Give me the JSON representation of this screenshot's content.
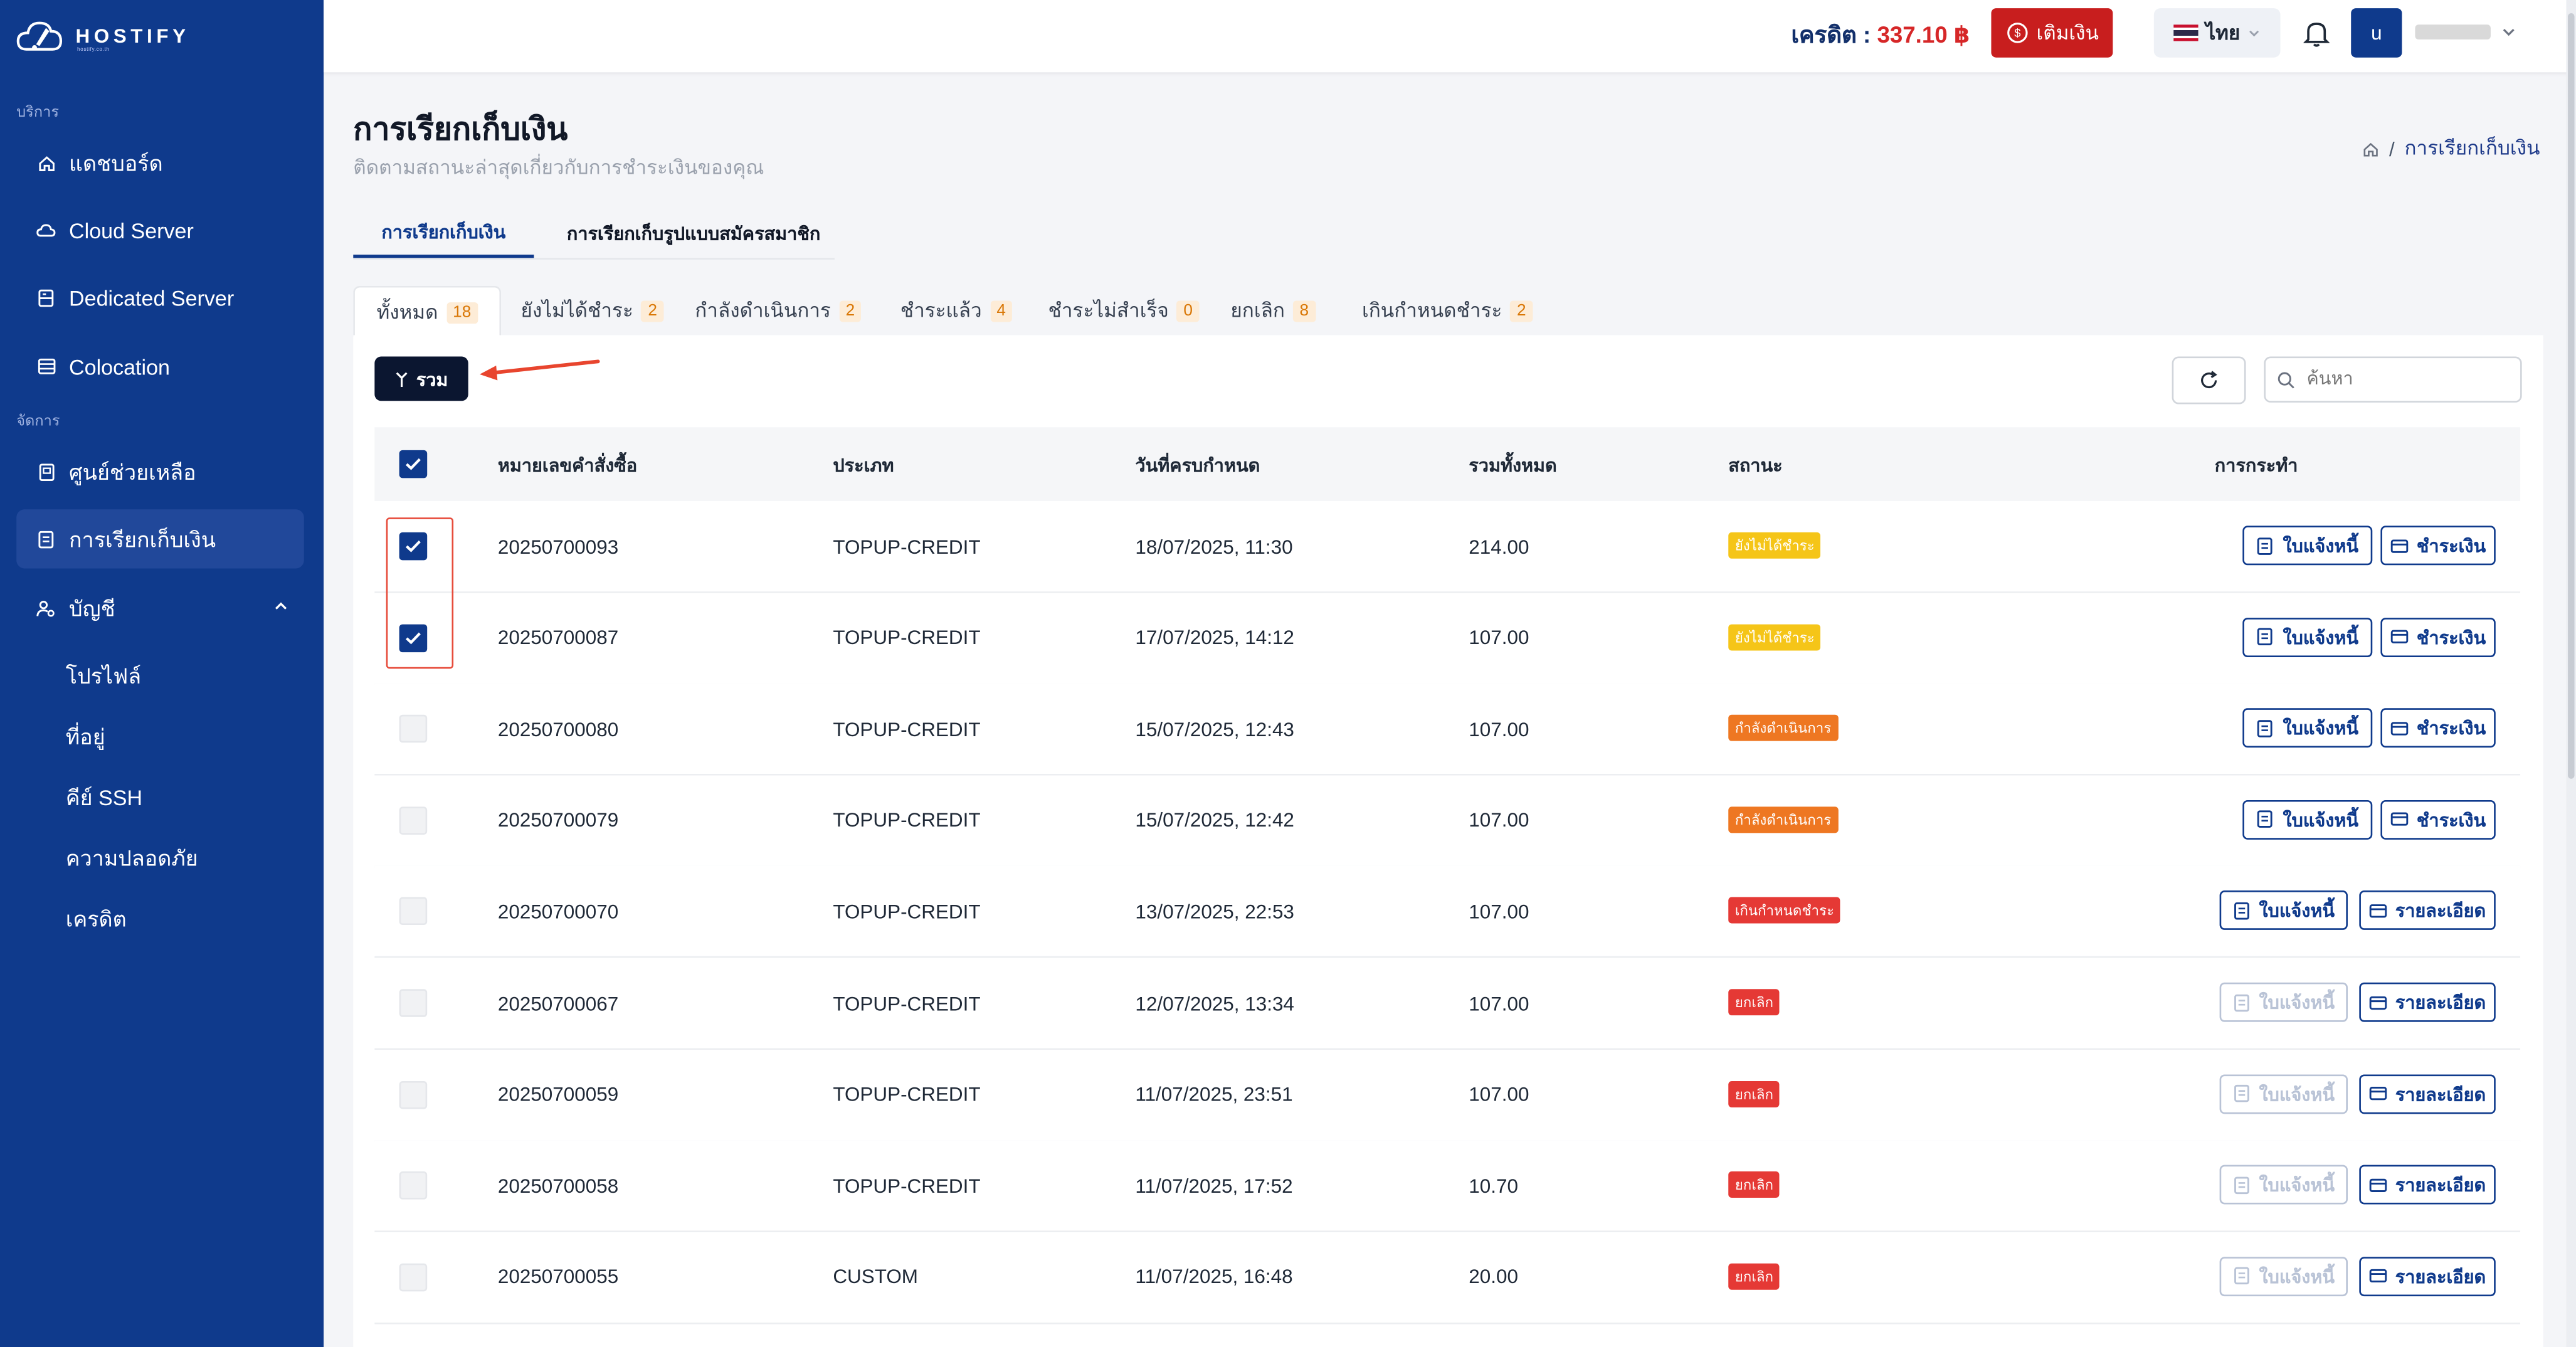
{
  "brand": {
    "name": "HOSTIFY",
    "tagline": "hostify.co.th"
  },
  "sidebar": {
    "section_services": "บริการ",
    "section_manage": "จัดการ",
    "items": [
      {
        "label": "แดชบอร์ด",
        "icon": "home-icon"
      },
      {
        "label": "Cloud Server",
        "icon": "cloud-icon"
      },
      {
        "label": "Dedicated Server",
        "icon": "server-icon"
      },
      {
        "label": "Colocation",
        "icon": "rack-icon"
      },
      {
        "label": "ศูนย์ช่วยเหลือ",
        "icon": "help-center-icon"
      },
      {
        "label": "การเรียกเก็บเงิน",
        "icon": "billing-icon",
        "active": true
      },
      {
        "label": "บัญชี",
        "icon": "account-icon",
        "expanded": true
      }
    ],
    "account_sub": [
      "โปรไฟล์",
      "ที่อยู่",
      "คีย์ SSH",
      "ความปลอดภัย",
      "เครดิต"
    ]
  },
  "topbar": {
    "credit_label": "เครดิต :",
    "credit_amount": "337.10 ฿",
    "topup_label": "เติมเงิน",
    "language": "ไทย",
    "avatar_initial": "u"
  },
  "page": {
    "title": "การเรียกเก็บเงิน",
    "subtitle": "ติดตามสถานะล่าสุดเกี่ยวกับการชำระเงินของคุณ",
    "breadcrumb_current": "การเรียกเก็บเงิน"
  },
  "main_tabs": [
    {
      "label": "การเรียกเก็บเงิน",
      "active": true
    },
    {
      "label": "การเรียกเก็บรูปแบบสมัครสมาชิก",
      "active": false
    }
  ],
  "status_tabs": [
    {
      "label": "ทั้งหมด",
      "count": "18",
      "active": true
    },
    {
      "label": "ยังไม่ได้ชำระ",
      "count": "2"
    },
    {
      "label": "กำลังดำเนินการ",
      "count": "2"
    },
    {
      "label": "ชำระแล้ว",
      "count": "4"
    },
    {
      "label": "ชำระไม่สำเร็จ",
      "count": "0"
    },
    {
      "label": "ยกเลิก",
      "count": "8"
    },
    {
      "label": "เกินกำหนดชำระ",
      "count": "2"
    }
  ],
  "toolbar": {
    "merge_label": "รวม",
    "search_placeholder": "ค้นหา"
  },
  "table": {
    "headers": [
      "หมายเลขคำสั่งซื้อ",
      "ประเภท",
      "วันที่ครบกำหนด",
      "รวมทั้งหมด",
      "สถานะ",
      "การกระทำ"
    ],
    "rows": [
      {
        "order": "20250700093",
        "type": "TOPUP-CREDIT",
        "due": "18/07/2025, 11:30",
        "total": "214.00",
        "status": "ยังไม่ได้ชำระ",
        "status_color": "#f5c518",
        "checked": true,
        "invoice": "ใบแจ้งหนี้",
        "invoice_enabled": true,
        "action2": "ชำระเงิน"
      },
      {
        "order": "20250700087",
        "type": "TOPUP-CREDIT",
        "due": "17/07/2025, 14:12",
        "total": "107.00",
        "status": "ยังไม่ได้ชำระ",
        "status_color": "#f5c518",
        "checked": true,
        "invoice": "ใบแจ้งหนี้",
        "invoice_enabled": true,
        "action2": "ชำระเงิน"
      },
      {
        "order": "20250700080",
        "type": "TOPUP-CREDIT",
        "due": "15/07/2025, 12:43",
        "total": "107.00",
        "status": "กำลังดำเนินการ",
        "status_color": "#ee7722",
        "checked": false,
        "invoice": "ใบแจ้งหนี้",
        "invoice_enabled": true,
        "action2": "ชำระเงิน"
      },
      {
        "order": "20250700079",
        "type": "TOPUP-CREDIT",
        "due": "15/07/2025, 12:42",
        "total": "107.00",
        "status": "กำลังดำเนินการ",
        "status_color": "#ee7722",
        "checked": false,
        "invoice": "ใบแจ้งหนี้",
        "invoice_enabled": true,
        "action2": "ชำระเงิน"
      },
      {
        "order": "20250700070",
        "type": "TOPUP-CREDIT",
        "due": "13/07/2025, 22:53",
        "total": "107.00",
        "status": "เกินกำหนดชำระ",
        "status_color": "#e53935",
        "checked": false,
        "invoice": "ใบแจ้งหนี้",
        "invoice_enabled": true,
        "action2": "รายละเอียด"
      },
      {
        "order": "20250700067",
        "type": "TOPUP-CREDIT",
        "due": "12/07/2025, 13:34",
        "total": "107.00",
        "status": "ยกเลิก",
        "status_color": "#e53935",
        "checked": false,
        "invoice": "ใบแจ้งหนี้",
        "invoice_enabled": false,
        "action2": "รายละเอียด"
      },
      {
        "order": "20250700059",
        "type": "TOPUP-CREDIT",
        "due": "11/07/2025, 23:51",
        "total": "107.00",
        "status": "ยกเลิก",
        "status_color": "#e53935",
        "checked": false,
        "invoice": "ใบแจ้งหนี้",
        "invoice_enabled": false,
        "action2": "รายละเอียด"
      },
      {
        "order": "20250700058",
        "type": "TOPUP-CREDIT",
        "due": "11/07/2025, 17:52",
        "total": "10.70",
        "status": "ยกเลิก",
        "status_color": "#e53935",
        "checked": false,
        "invoice": "ใบแจ้งหนี้",
        "invoice_enabled": false,
        "action2": "รายละเอียด"
      },
      {
        "order": "20250700055",
        "type": "CUSTOM",
        "due": "11/07/2025, 16:48",
        "total": "20.00",
        "status": "ยกเลิก",
        "status_color": "#e53935",
        "checked": false,
        "invoice": "ใบแจ้งหนี้",
        "invoice_enabled": false,
        "action2": "รายละเอียด"
      }
    ]
  },
  "colors": {
    "primary": "#0f3a8c",
    "danger": "#c81e1e",
    "accent_amount": "#d62728"
  }
}
